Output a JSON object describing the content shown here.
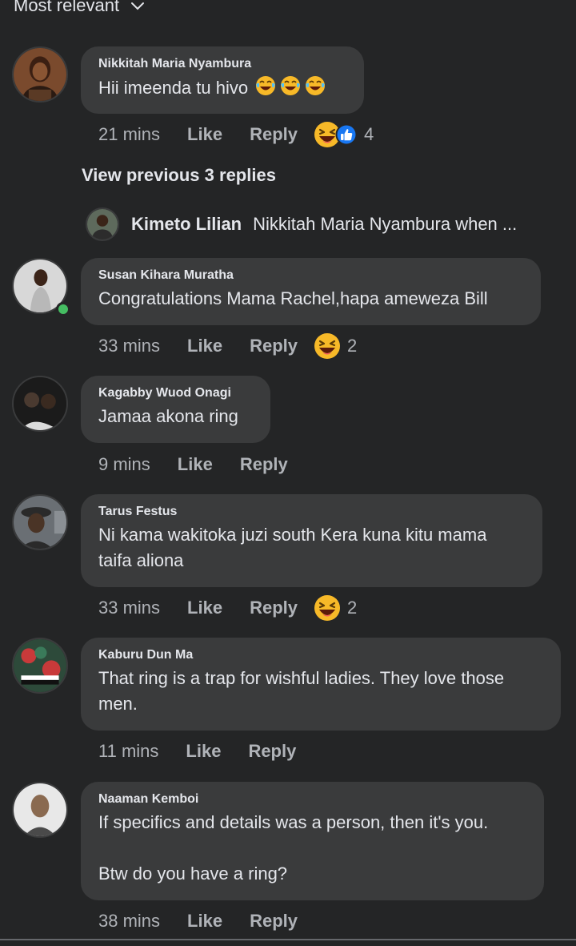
{
  "sort": {
    "label": "Most relevant"
  },
  "comments": [
    {
      "author": "Nikkitah Maria Nyambura",
      "text": "Hii imeenda tu hivo",
      "time": "21 mins",
      "like": "Like",
      "reply": "Reply",
      "reaction_count": "4",
      "reactions": [
        "laughing-face-icon",
        "like-thumb-icon"
      ],
      "inline_emojis": [
        "tears-of-joy-icon",
        "tears-of-joy-icon",
        "tears-of-joy-icon"
      ]
    },
    {
      "author": "Susan Kihara Muratha",
      "text": "Congratulations Mama Rachel,hapa ameweza Bill",
      "time": "33 mins",
      "like": "Like",
      "reply": "Reply",
      "reaction_count": "2",
      "online": true
    },
    {
      "author": "Kagabby Wuod Onagi",
      "text": "Jamaa akona ring",
      "time": "9 mins",
      "like": "Like",
      "reply": "Reply"
    },
    {
      "author": "Tarus Festus",
      "text": "Ni kama wakitoka juzi south Kera kuna kitu mama taifa aliona",
      "time": "33 mins",
      "like": "Like",
      "reply": "Reply",
      "reaction_count": "2"
    },
    {
      "author": "Kaburu Dun Ma",
      "text": "That ring is a trap for wishful ladies. They love those men.",
      "time": "11 mins",
      "like": "Like",
      "reply": "Reply"
    },
    {
      "author": "Naaman Kemboi",
      "text": "If specifics and details was a person, then it's you.\n\nBtw do you have a ring?",
      "time": "38 mins",
      "like": "Like",
      "reply": "Reply"
    }
  ],
  "replies_preview": {
    "view_previous": "View previous 3 replies",
    "author": "Kimeto Lilian",
    "text": "Nikkitah Maria Nyambura  when ..."
  },
  "colors": {
    "background": "#242526",
    "bubble": "#3a3b3c",
    "text": "#e4e6eb",
    "muted": "#b0b3b8",
    "online": "#45bd62",
    "like_blue": "#1877f2",
    "emoji_yellow": "#f7b928"
  }
}
